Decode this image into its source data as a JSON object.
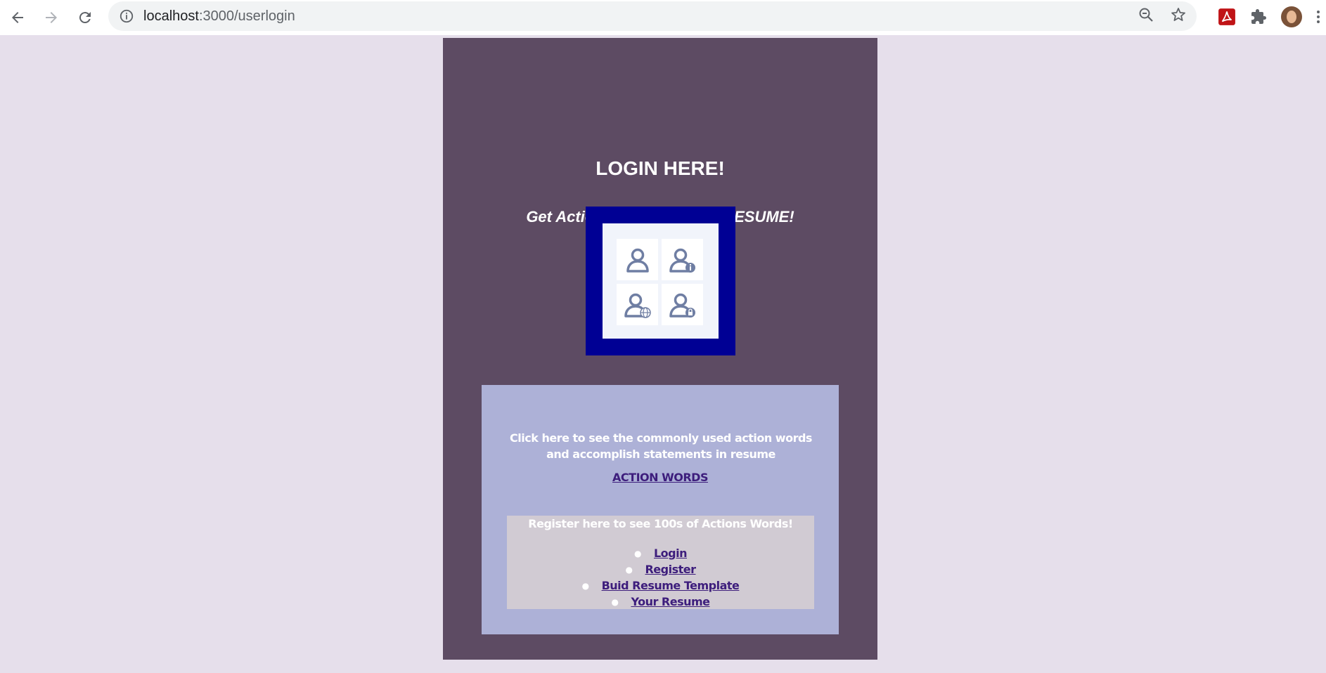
{
  "browser": {
    "url_host": "localhost",
    "url_path": ":3000/userlogin"
  },
  "page": {
    "title": "LOGIN HERE!",
    "subtitle": "Get Action Words for your RESUME!",
    "info_text": "Click here to see the commonly used action words and accomplish statements in resume",
    "action_link": "ACTION WORDS",
    "register_text": "Register here to see 100s of Actions Words!",
    "menu": [
      {
        "label": "Login"
      },
      {
        "label": "Register"
      },
      {
        "label": "Buid Resume Template"
      },
      {
        "label": "Your Resume"
      }
    ]
  },
  "colors": {
    "page_bg": "#e6dfeb",
    "panel_bg": "#5d4b63",
    "box_bg": "#adb1d7",
    "register_bg": "#d1cbd3",
    "link": "#3d1d7c",
    "logo_frame": "#000094"
  },
  "icons": [
    "back-arrow-icon",
    "forward-arrow-icon",
    "reload-icon",
    "info-icon",
    "zoom-out-icon",
    "star-icon",
    "pdf-extension-icon",
    "puzzle-extension-icon",
    "profile-avatar",
    "menu-dots-icon"
  ]
}
